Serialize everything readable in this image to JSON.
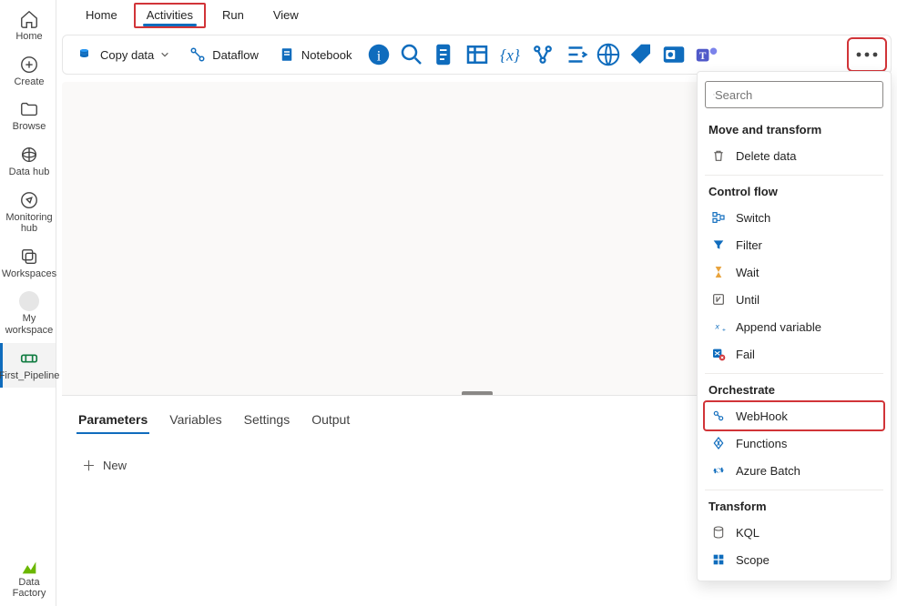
{
  "leftRail": {
    "items": [
      {
        "key": "home",
        "label": "Home"
      },
      {
        "key": "create",
        "label": "Create"
      },
      {
        "key": "browse",
        "label": "Browse"
      },
      {
        "key": "datahub",
        "label": "Data hub"
      },
      {
        "key": "monitoring",
        "label": "Monitoring hub"
      },
      {
        "key": "workspaces",
        "label": "Workspaces"
      },
      {
        "key": "myworkspace",
        "label": "My workspace"
      },
      {
        "key": "pipeline",
        "label": "First_Pipeline"
      }
    ],
    "footer": {
      "label": "Data Factory"
    }
  },
  "topTabs": {
    "items": [
      {
        "label": "Home"
      },
      {
        "label": "Activities"
      },
      {
        "label": "Run"
      },
      {
        "label": "View"
      }
    ]
  },
  "ribbon": {
    "copyData": "Copy data",
    "dataflow": "Dataflow",
    "notebook": "Notebook"
  },
  "bottomTabs": {
    "items": [
      {
        "label": "Parameters"
      },
      {
        "label": "Variables"
      },
      {
        "label": "Settings"
      },
      {
        "label": "Output"
      }
    ],
    "newLabel": "New"
  },
  "dropdown": {
    "searchPlaceholder": "Search",
    "sections": [
      {
        "title": "Move and transform",
        "items": [
          {
            "label": "Delete data",
            "icon": "trash"
          }
        ]
      },
      {
        "title": "Control flow",
        "items": [
          {
            "label": "Switch",
            "icon": "switch"
          },
          {
            "label": "Filter",
            "icon": "filter"
          },
          {
            "label": "Wait",
            "icon": "wait"
          },
          {
            "label": "Until",
            "icon": "until"
          },
          {
            "label": "Append variable",
            "icon": "append"
          },
          {
            "label": "Fail",
            "icon": "fail"
          }
        ]
      },
      {
        "title": "Orchestrate",
        "items": [
          {
            "label": "WebHook",
            "icon": "webhook",
            "highlight": true
          },
          {
            "label": "Functions",
            "icon": "functions"
          },
          {
            "label": "Azure Batch",
            "icon": "batch"
          }
        ]
      },
      {
        "title": "Transform",
        "items": [
          {
            "label": "KQL",
            "icon": "kql"
          },
          {
            "label": "Scope",
            "icon": "scope"
          }
        ]
      }
    ]
  }
}
